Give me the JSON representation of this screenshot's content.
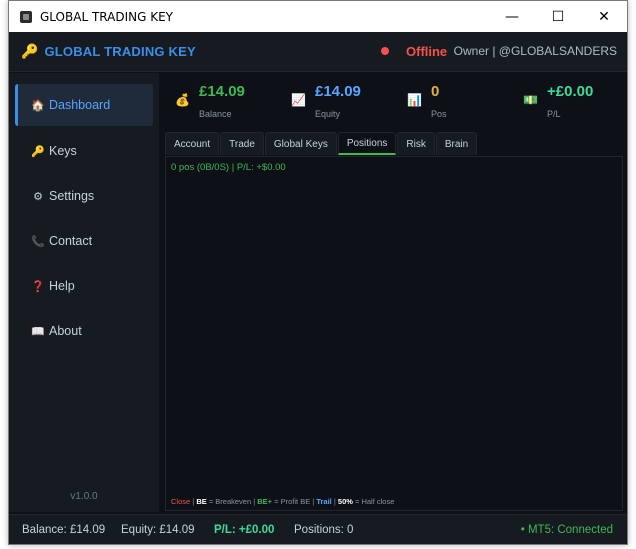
{
  "window": {
    "title": "GLOBAL TRADING KEY",
    "controls": {
      "minimize": "—",
      "maximize": "☐",
      "close": "✕"
    }
  },
  "header": {
    "brand": "GLOBAL TRADING KEY",
    "status": "Offline",
    "owner": "Owner | @GLOBALSANDERS",
    "status_color": "#f85149",
    "brand_color": "#3b8eea"
  },
  "sidebar": {
    "items": [
      {
        "label": "Dashboard",
        "icon": "house-icon",
        "glyph": "🏠",
        "active": true
      },
      {
        "label": "Keys",
        "icon": "key-icon",
        "glyph": "🔑",
        "active": false
      },
      {
        "label": "Settings",
        "icon": "gear-icon",
        "glyph": "⚙",
        "active": false
      },
      {
        "label": "Contact",
        "icon": "phone-icon",
        "glyph": "📞",
        "active": false
      },
      {
        "label": "Help",
        "icon": "question-icon",
        "glyph": "❓",
        "active": false
      },
      {
        "label": "About",
        "icon": "book-icon",
        "glyph": "📖",
        "active": false
      }
    ],
    "version": "v1.0.0"
  },
  "stats": [
    {
      "value": "£14.09",
      "label": "Balance",
      "icon": "money-bag-icon",
      "glyph": "💰",
      "color": "#3fb950"
    },
    {
      "value": "£14.09",
      "label": "Equity",
      "icon": "chart-up-icon",
      "glyph": "📈",
      "color": "#58a6ff"
    },
    {
      "value": "0",
      "label": "Pos",
      "icon": "bar-chart-icon",
      "glyph": "📊",
      "color": "#e3b341"
    },
    {
      "value": "+£0.00",
      "label": "P/L",
      "icon": "banknote-icon",
      "glyph": "💵",
      "color": "#3fdc97"
    }
  ],
  "tabs": [
    {
      "label": "Account",
      "active": false
    },
    {
      "label": "Trade",
      "active": false
    },
    {
      "label": "Global Keys",
      "active": false
    },
    {
      "label": "Positions",
      "active": true
    },
    {
      "label": "Risk",
      "active": false
    },
    {
      "label": "Brain",
      "active": false
    }
  ],
  "positions": {
    "summary": "0 pos (0B/0S) | P/L: +$0.00",
    "legend": {
      "close": "Close",
      "sep1": " | ",
      "be": "BE",
      "be_desc": " = Breakeven | ",
      "bep": "BE+",
      "bep_desc": " = Profit BE | ",
      "trail": "Trail",
      "sep2": " | ",
      "half": "50%",
      "half_desc": " = Half close"
    }
  },
  "statusbar": {
    "balance": "Balance: £14.09",
    "equity": "Equity: £14.09",
    "pl": "P/L: +£0.00",
    "positions": "Positions: 0",
    "connection": "• MT5: Connected",
    "connection_color": "#3fb950"
  }
}
